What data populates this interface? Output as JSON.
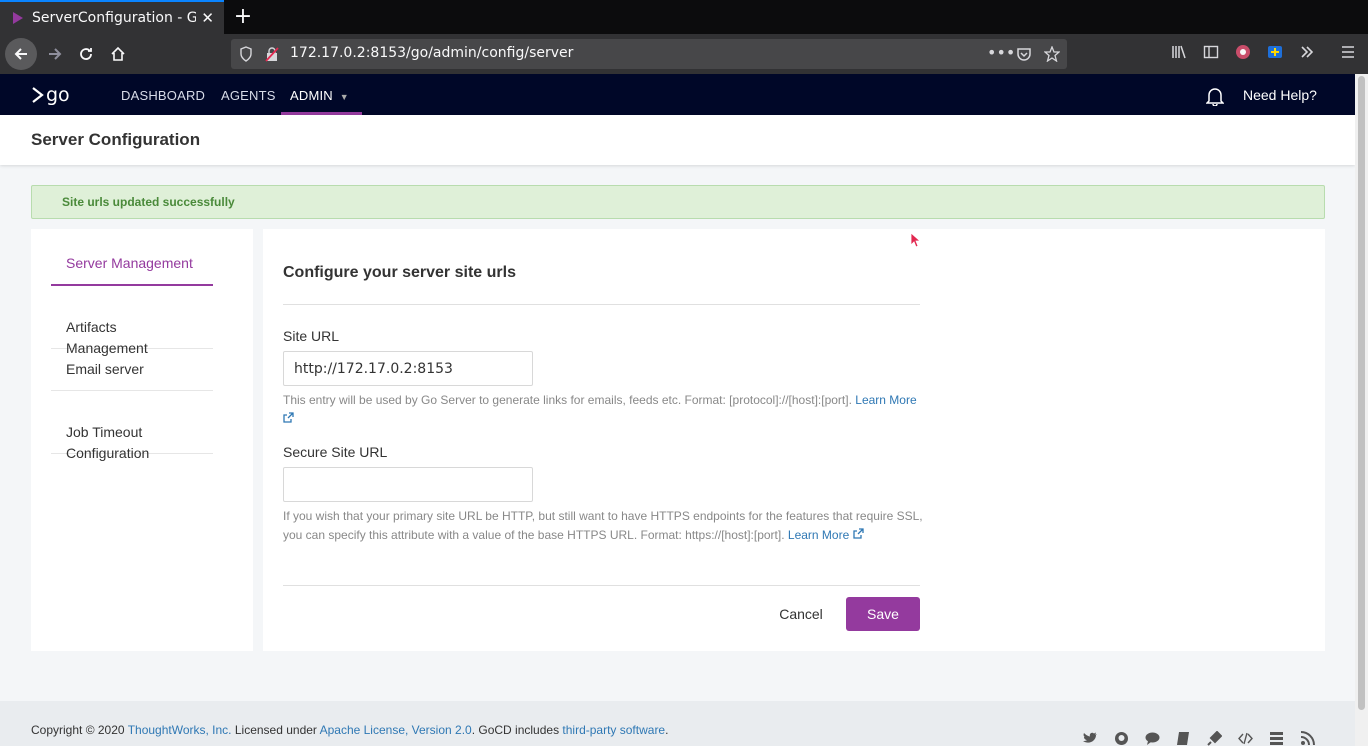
{
  "browser": {
    "tab_title": "ServerConfiguration - Go",
    "url": "172.17.0.2:8153/go/admin/config/server"
  },
  "header": {
    "logo_text": "go",
    "nav": [
      "DASHBOARD",
      "AGENTS",
      "ADMIN"
    ],
    "need_help": "Need Help?"
  },
  "page": {
    "title": "Server Configuration",
    "flash": "Site urls updated successfully"
  },
  "sidebar": {
    "items": [
      {
        "label": "Server Management"
      },
      {
        "label": "Artifacts\nManagement"
      },
      {
        "label": "Email server"
      },
      {
        "label": "Job Timeout\nConfiguration"
      }
    ]
  },
  "form": {
    "title": "Configure your server site urls",
    "site_url_label": "Site URL",
    "site_url_value": "http://172.17.0.2:8153",
    "site_url_help": "This entry will be used by Go Server to generate links for emails, feeds etc. Format: [protocol]://[host]:[port].",
    "secure_url_label": "Secure Site URL",
    "secure_url_value": "",
    "secure_url_help": "If you wish that your primary site URL be HTTP, but still want to have HTTPS endpoints for the features that require SSL, you can specify this attribute with a value of the base HTTPS URL. Format: https://[host]:[port].",
    "learn_more": "Learn More",
    "cancel": "Cancel",
    "save": "Save"
  },
  "footer": {
    "copyright": "Copyright © 2020 ",
    "company": "ThoughtWorks, Inc.",
    "licensed": " Licensed under ",
    "license": "Apache License, Version 2.0",
    "includes": ". GoCD includes ",
    "third_party": "third-party software",
    "end": "."
  },
  "colors": {
    "accent": "#943a9e",
    "header_bg": "#000728",
    "link": "#2f78b4",
    "flash_bg": "#dff0d8"
  }
}
